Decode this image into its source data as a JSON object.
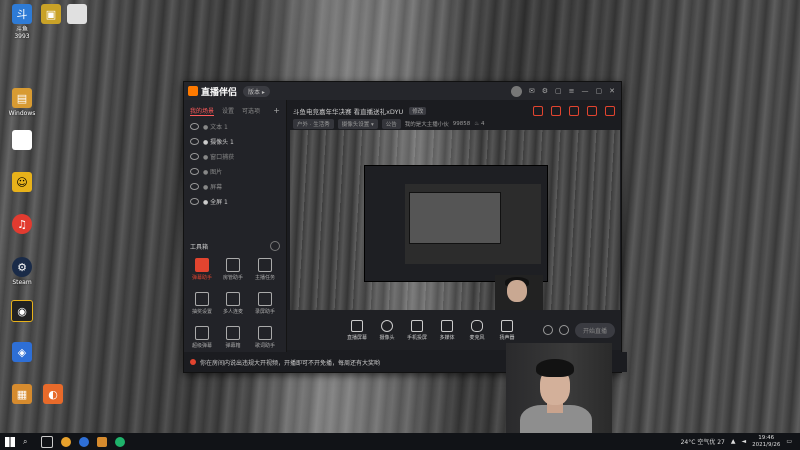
{
  "desktop": {
    "icons": [
      {
        "name": "app-icon-1",
        "label": "斗鱼",
        "color": "#2e7bd6"
      },
      {
        "name": "app-icon-2",
        "label": "",
        "color": "#c9a227"
      },
      {
        "name": "app-icon-3",
        "label": "",
        "color": "#e0e0e0"
      },
      {
        "name": "app-icon-4",
        "label": "Windows",
        "color": "#d89b32"
      },
      {
        "name": "app-icon-5",
        "label": "",
        "color": "#ffffff"
      },
      {
        "name": "app-icon-6",
        "label": "",
        "color": "#e8b21a"
      },
      {
        "name": "app-icon-7",
        "label": "",
        "color": "#e23b30"
      },
      {
        "name": "app-icon-8",
        "label": "Steam",
        "color": "#1a2b48"
      },
      {
        "name": "app-icon-9",
        "label": "",
        "color": "#222222"
      },
      {
        "name": "app-icon-10",
        "label": "",
        "color": "#2e6fd6"
      },
      {
        "name": "app-icon-11",
        "label": "",
        "color": "#d68b2e"
      }
    ],
    "top_label": "3993"
  },
  "window": {
    "app_name": "直播伴侣",
    "version_label": "版本 ▸",
    "tabs": [
      "我的场景",
      "设置",
      "可选项"
    ],
    "tabs_plus": "+",
    "scenes": [
      "● 文本 1",
      "● 摄像头 1",
      "● 窗口捕获",
      "● 图片",
      "● 屏幕",
      "● 全屏 1"
    ],
    "tools_title": "工具箱",
    "tools": [
      {
        "label": "弹幕助手",
        "red": true
      },
      {
        "label": "房管助手",
        "red": false
      },
      {
        "label": "主播任务",
        "red": false
      },
      {
        "label": "抽奖设置",
        "red": false
      },
      {
        "label": "多人连麦",
        "red": false
      },
      {
        "label": "录屏助手",
        "red": false
      },
      {
        "label": "超级弹幕",
        "red": false
      },
      {
        "label": "弹幕箱",
        "red": false
      },
      {
        "label": "歌词助手",
        "red": false
      },
      {
        "label": "",
        "red": true
      },
      {
        "label": "",
        "red": false
      },
      {
        "label": "",
        "red": false
      }
    ],
    "room_title": "斗鱼电竞嘉年华决赛 看直播送礼xDYU",
    "room_tag": "修改",
    "row2": [
      "户外 · 生活秀",
      "摄像头设置 ▾",
      "公告",
      "我的是大主播小伙",
      "99858",
      "♨ 4"
    ],
    "bottom_buttons": [
      "直播屏幕",
      "摄像头",
      "手机投屏",
      "多媒体",
      "麦克风",
      "扬声器"
    ],
    "live_button": "开始直播",
    "notice": "你在房间内说出违规大开视频，开播即可不开免播，每周还有大奖哟"
  },
  "taskbar": {
    "weather": "24°C  空气优 27",
    "time": "19:46",
    "date": "2021/9/26"
  },
  "colors": {
    "accent_red": "#e2442f",
    "brand_orange": "#ff7a00"
  }
}
